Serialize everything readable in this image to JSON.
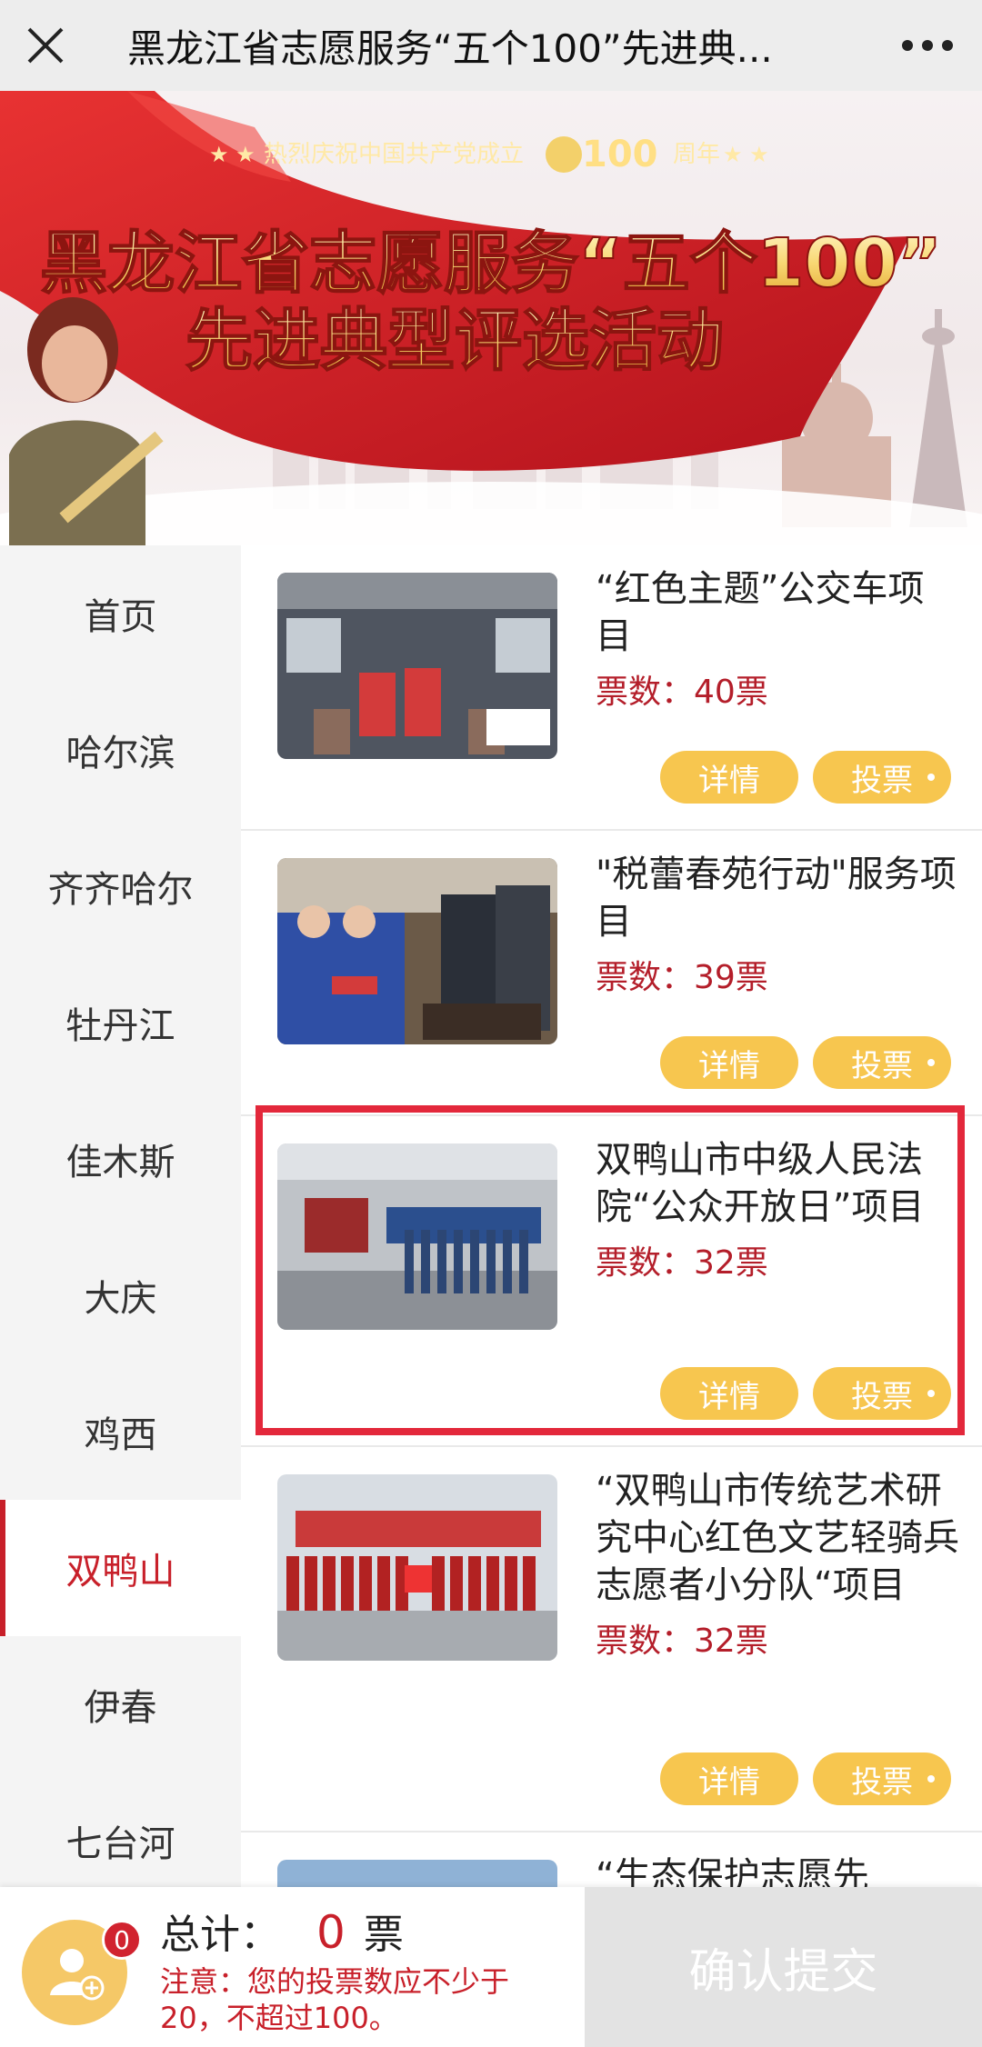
{
  "topbar": {
    "title": "黑龙江省志愿服务“五个100”先进典...",
    "close_icon": "close-icon",
    "more_icon": "more-icon"
  },
  "banner": {
    "top_slogan": "热烈庆祝中国共产党成立",
    "anniversary_number": "100",
    "anniversary_suffix": "周年",
    "title_line1": "黑龙江省志愿服务“五个100”",
    "title_line2": "先进典型评选活动"
  },
  "sidebar": {
    "items": [
      {
        "label": "首页"
      },
      {
        "label": "哈尔滨"
      },
      {
        "label": "齐齐哈尔"
      },
      {
        "label": "牡丹江"
      },
      {
        "label": "佳木斯"
      },
      {
        "label": "大庆"
      },
      {
        "label": "鸡西"
      },
      {
        "label": "双鸭山"
      },
      {
        "label": "伊春"
      },
      {
        "label": "七台河"
      }
    ],
    "active_index": 7
  },
  "projects": {
    "detail_label": "详情",
    "vote_label": "投票",
    "items": [
      {
        "name": "“红色主题”公交车项目",
        "votes": "票数：40票"
      },
      {
        "name": "\"税蕾春苑行动\"服务项目",
        "votes": "票数：39票"
      },
      {
        "name": "双鸭山市中级人民法院“公众开放日”项目",
        "votes": "票数：32票"
      },
      {
        "name": "“双鸭山市传统艺术研究中心红色文艺轻骑兵志愿者小分队“项目",
        "votes": "票数：32票"
      },
      {
        "name": "“生态保护志愿先",
        "votes": ""
      }
    ]
  },
  "bottom": {
    "badge_count": "0",
    "total_label": "总计：",
    "total_value": "0",
    "total_unit": "票",
    "note": "注意：您的投票数应不少于20，不超过100。",
    "submit_label": "确认提交"
  },
  "colors": {
    "accent_red": "#c8202a",
    "highlight_red": "#e3283b",
    "button_yellow": "#f7c64f",
    "sidebar_bg": "#f4f4f4"
  }
}
